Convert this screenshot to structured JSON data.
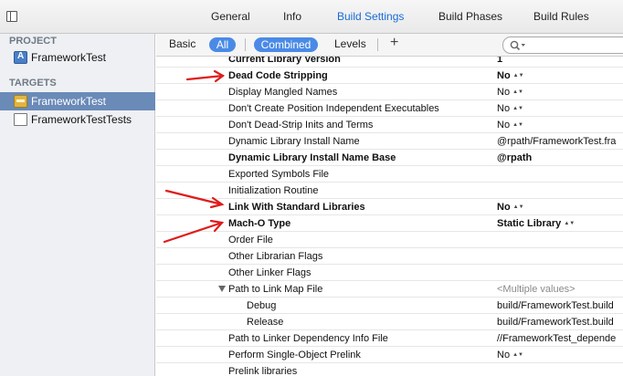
{
  "top_tabs": [
    "General",
    "Info",
    "Build Settings",
    "Build Phases",
    "Build Rules"
  ],
  "active_tab": "Build Settings",
  "sidebar": {
    "project_header": "PROJECT",
    "project_item": "FrameworkTest",
    "targets_header": "TARGETS",
    "targets": [
      {
        "label": "FrameworkTest",
        "selected": true,
        "icon": "framework-target-icon"
      },
      {
        "label": "FrameworkTestTests",
        "selected": false,
        "icon": "test-target-icon"
      }
    ]
  },
  "filter": {
    "basic": "Basic",
    "all": "All",
    "combined": "Combined",
    "levels": "Levels",
    "add": "+",
    "search_placeholder": ""
  },
  "settings": [
    {
      "name": "Current Library Version",
      "value": "1",
      "bold": true
    },
    {
      "name": "Dead Code Stripping",
      "value": "No",
      "bold": true,
      "stepper": true
    },
    {
      "name": "Display Mangled Names",
      "value": "No",
      "stepper": true
    },
    {
      "name": "Don't Create Position Independent Executables",
      "value": "No",
      "stepper": true
    },
    {
      "name": "Don't Dead-Strip Inits and Terms",
      "value": "No",
      "stepper": true
    },
    {
      "name": "Dynamic Library Install Name",
      "value": "@rpath/FrameworkTest.fra"
    },
    {
      "name": "Dynamic Library Install Name Base",
      "value": "@rpath",
      "bold": true
    },
    {
      "name": "Exported Symbols File",
      "value": ""
    },
    {
      "name": "Initialization Routine",
      "value": ""
    },
    {
      "name": "Link With Standard Libraries",
      "value": "No",
      "bold": true,
      "stepper": true
    },
    {
      "name": "Mach-O Type",
      "value": "Static Library",
      "bold": true,
      "stepper": true
    },
    {
      "name": "Order File",
      "value": ""
    },
    {
      "name": "Other Librarian Flags",
      "value": ""
    },
    {
      "name": "Other Linker Flags",
      "value": ""
    },
    {
      "name": "Path to Link Map File",
      "value": "<Multiple values>",
      "dim": true,
      "expanded": true
    },
    {
      "name": "Debug",
      "value": "build/FrameworkTest.build",
      "sub": true
    },
    {
      "name": "Release",
      "value": "build/FrameworkTest.build",
      "sub": true
    },
    {
      "name": "Path to Linker Dependency Info File",
      "value": "//FrameworkTest_depende"
    },
    {
      "name": "Perform Single-Object Prelink",
      "value": "No",
      "stepper": true
    },
    {
      "name": "Prelink libraries",
      "value": ""
    }
  ],
  "colors": {
    "accent": "#1a6bd8",
    "pill": "#4a8ae6",
    "selection": "#6a8ab8",
    "annotation": "#e01b1b"
  }
}
